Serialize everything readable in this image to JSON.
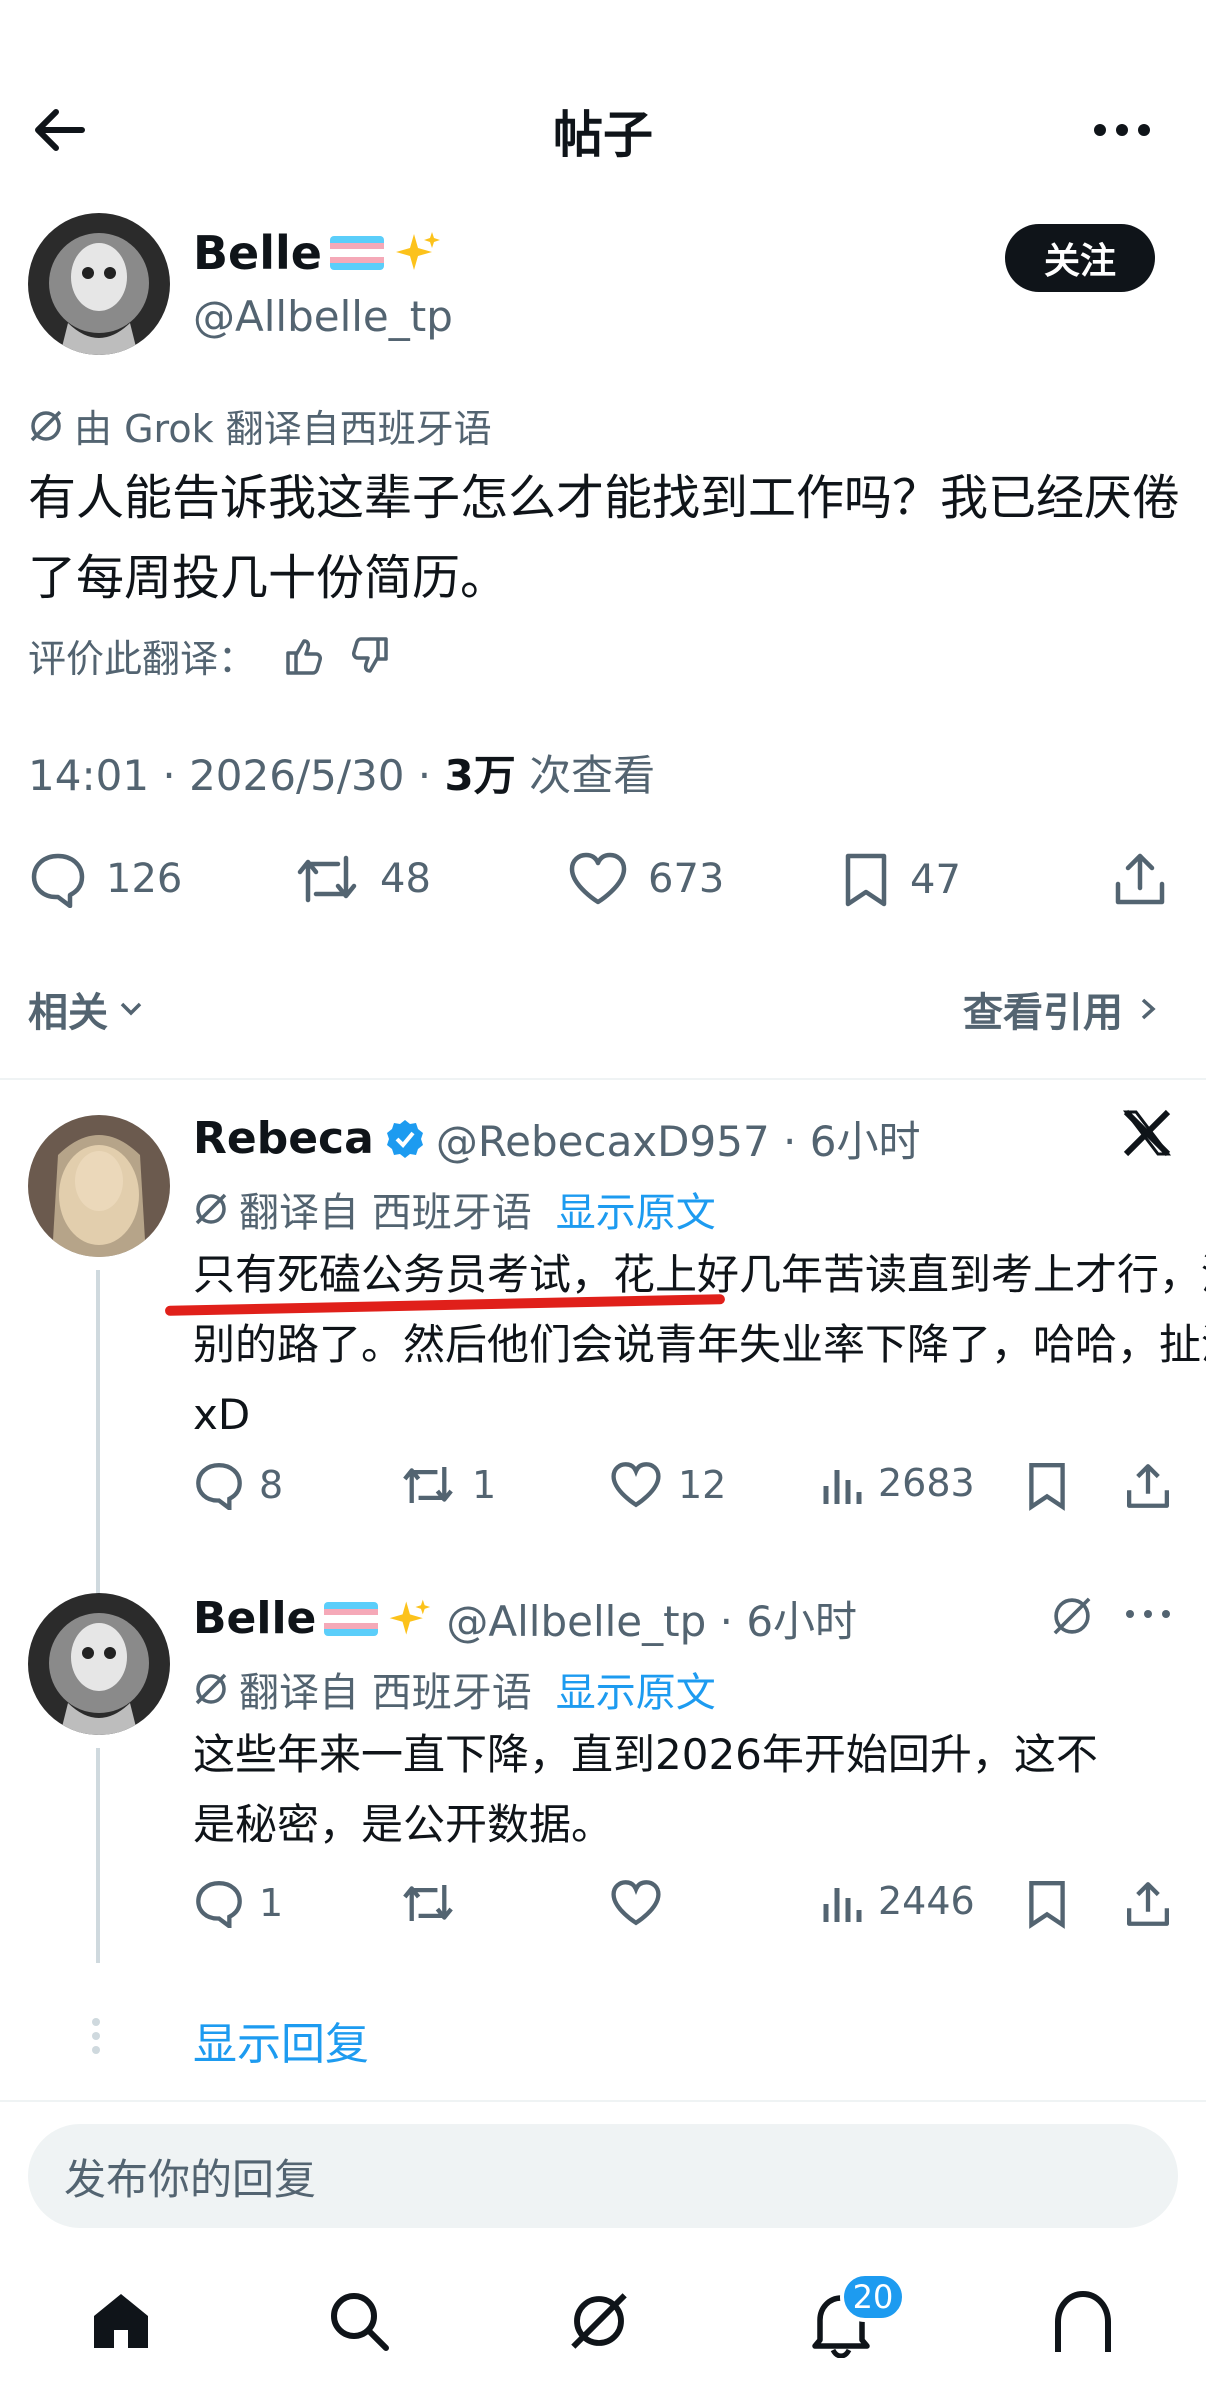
{
  "header": {
    "title": "帖子"
  },
  "post": {
    "author_name": "Belle",
    "author_handle": "@Allbelle_tp",
    "follow_label": "关注",
    "translation_note": "由 Grok 翻译自西班牙语",
    "text": "有人能告诉我这辈子怎么才能找到工作吗？我已经厌倦了每周投几十份简历。",
    "rate_label": "评价此翻译：",
    "meta_time": "14:01 · 2026/5/30 · ",
    "meta_views": "3万",
    "meta_views_label": " 次查看",
    "stats": {
      "replies": "126",
      "reposts": "48",
      "likes": "673",
      "bookmarks": "47"
    },
    "related_label": "相关",
    "quotes_label": "查看引用"
  },
  "replies": [
    {
      "name": "Rebeca",
      "handle_time": "@RebecaxD957 · 6小时",
      "translation_note": "翻译自 西班牙语",
      "show_original": "显示原文",
      "text": "只有死磕公务员考试，花上好几年苦读直到考上才行，没别的路了。然后他们会说青年失业率下降了，哈哈，扯淡 xD",
      "replies": "8",
      "reposts": "1",
      "likes": "12",
      "views": "2683"
    },
    {
      "name": "Belle",
      "handle_time": "@Allbelle_tp · 6小时",
      "translation_note": "翻译自 西班牙语",
      "show_original": "显示原文",
      "text": "这些年来一直下降，直到2026年开始回升，这不是秘密，是公开数据。",
      "replies": "1",
      "reposts": "",
      "likes": "",
      "views": "2446"
    }
  ],
  "show_replies_label": "显示回复",
  "composer": {
    "placeholder": "发布你的回复"
  },
  "bottom_nav": {
    "notification_count": "20"
  },
  "colors": {
    "accent": "#1d9bf0",
    "highlight_underline": "#e0201a",
    "text": "#0f1419",
    "muted": "#536471"
  }
}
